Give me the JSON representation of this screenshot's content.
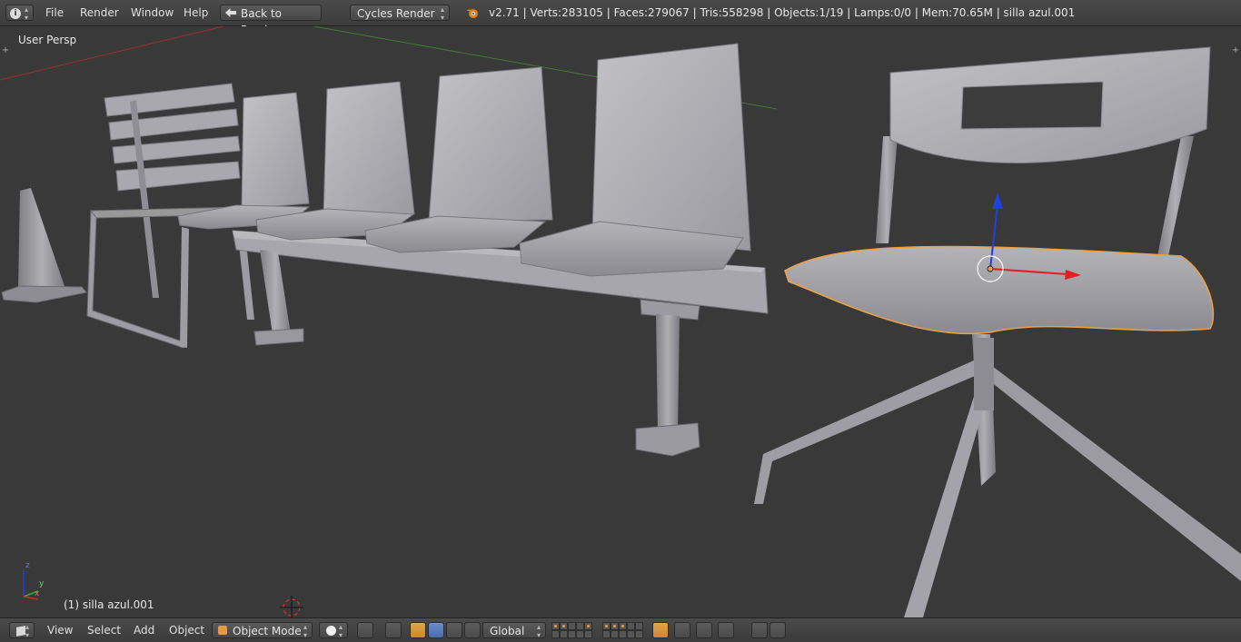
{
  "topbar": {
    "info_icon": "info-icon",
    "menus": [
      "File",
      "Render",
      "Window",
      "Help"
    ],
    "back_button": "Back to Previous",
    "engine": "Cycles Render",
    "stats": "v2.71 | Verts:283105 | Faces:279067 | Tris:558298 | Objects:1/19 | Lamps:0/0 | Mem:70.65M | silla azul.001"
  },
  "viewport": {
    "view_label": "User Persp",
    "object_label": "(1) silla azul.001",
    "axis_x": "x",
    "axis_y": "y",
    "axis_z": "z"
  },
  "bottombar": {
    "view": "View",
    "select": "Select",
    "add": "Add",
    "object": "Object",
    "mode": "Object Mode",
    "orientation": "Global"
  },
  "colors": {
    "selection_outline": "#f0a040",
    "x_axis": "#e02020",
    "z_axis": "#2040e0",
    "active_tool": "#e2a44a"
  }
}
